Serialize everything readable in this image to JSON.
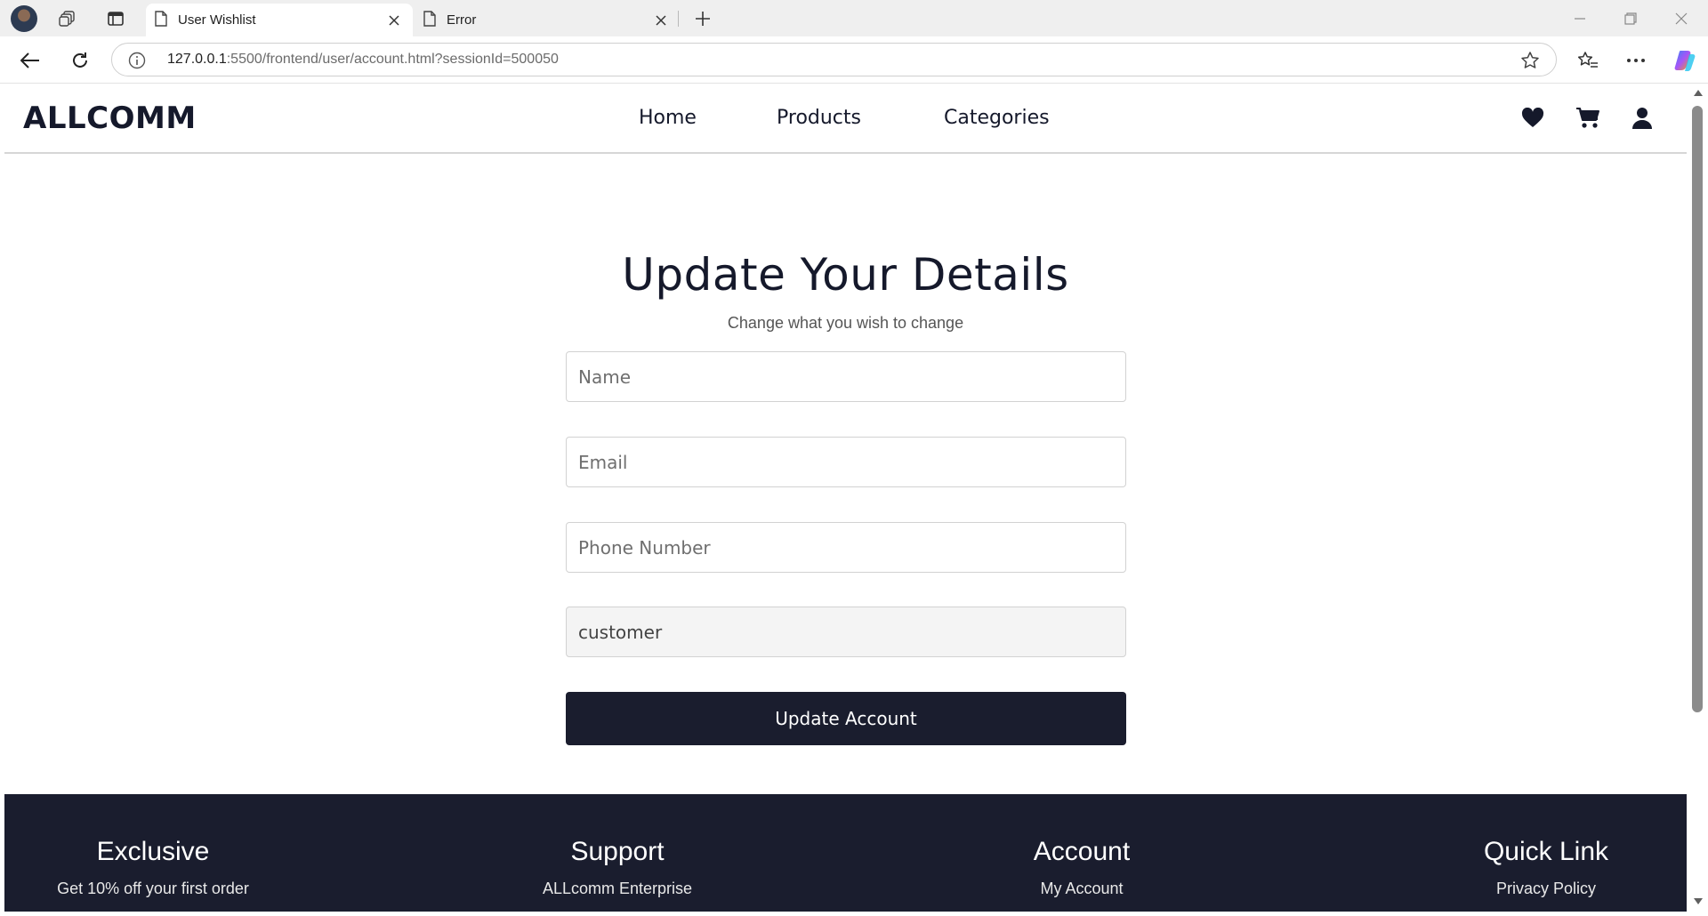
{
  "browser": {
    "tabs": [
      {
        "title": "User Wishlist",
        "active": true
      },
      {
        "title": "Error",
        "active": false
      }
    ],
    "url_host": "127.0.0.1",
    "url_rest": ":5500/frontend/user/account.html?sessionId=500050"
  },
  "header": {
    "logo": "ALLCOMM",
    "nav": [
      "Home",
      "Products",
      "Categories"
    ],
    "icons": [
      "heart-icon",
      "cart-icon",
      "user-icon"
    ]
  },
  "form": {
    "title": "Update Your Details",
    "subtitle": "Change what you wish to change",
    "name_placeholder": "Name",
    "email_placeholder": "Email",
    "phone_placeholder": "Phone Number",
    "role_value": "customer",
    "submit_label": "Update Account"
  },
  "footer": {
    "columns": [
      {
        "heading": "Exclusive",
        "item": "Get 10% off your first order"
      },
      {
        "heading": "Support",
        "item": "ALLcomm Enterprise"
      },
      {
        "heading": "Account",
        "item": "My Account"
      },
      {
        "heading": "Quick Link",
        "item": "Privacy Policy"
      }
    ]
  },
  "colors": {
    "brand_dark": "#1a1d2e",
    "text_dark": "#15192b"
  }
}
